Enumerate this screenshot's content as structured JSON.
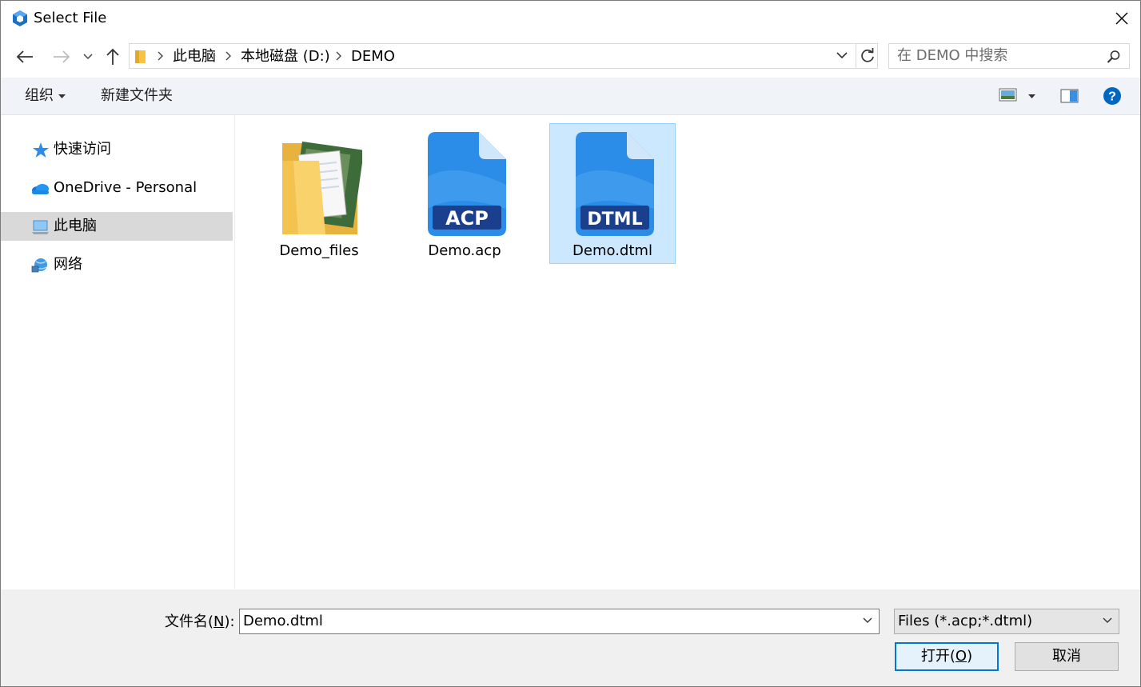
{
  "window": {
    "title": "Select File"
  },
  "address": {
    "crumbs": [
      "此电脑",
      "本地磁盘 (D:)",
      "DEMO"
    ]
  },
  "search": {
    "placeholder": "在 DEMO 中搜索"
  },
  "toolbar": {
    "organize": "组织",
    "new_folder": "新建文件夹"
  },
  "sidebar": {
    "items": [
      {
        "label": "快速访问",
        "icon": "star-icon"
      },
      {
        "label": "OneDrive - Personal",
        "icon": "cloud-icon"
      },
      {
        "label": "此电脑",
        "icon": "computer-icon",
        "selected": true
      },
      {
        "label": "网络",
        "icon": "network-icon"
      }
    ]
  },
  "files": [
    {
      "name": "Demo_files",
      "icon": "folder-icon"
    },
    {
      "name": "Demo.acp",
      "icon": "acp-file-icon",
      "badge": "ACP"
    },
    {
      "name": "Demo.dtml",
      "icon": "dtml-file-icon",
      "badge": "DTML",
      "selected": true
    }
  ],
  "footer": {
    "filename_label_main": "文件名(",
    "filename_label_key": "N",
    "filename_label_end": "):",
    "filename_value": "Demo.dtml",
    "filetype_value": "Files (*.acp;*.dtml)",
    "open_main": "打开(",
    "open_key": "O",
    "open_end": ")",
    "cancel": "取消"
  },
  "colors": {
    "accent": "#0078d7",
    "selection": "#cce8ff",
    "file_icon_blue": "#2b8de8",
    "file_badge_dark": "#1a3f8c"
  }
}
